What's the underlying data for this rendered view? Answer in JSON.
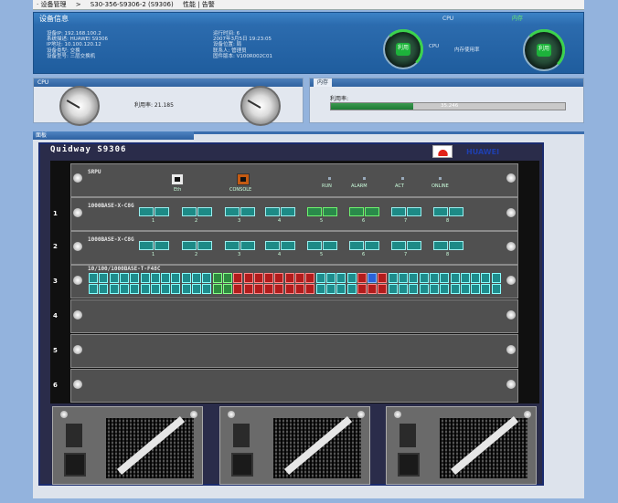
{
  "topbar": {
    "item1": "· 设备管理",
    "sep": ">",
    "item2": "S30-356-S9306-2 (S9306)",
    "item3": "性能 | 告警"
  },
  "info": {
    "header": "设备信息",
    "left_rows": [
      "设备IP: 192.168.100.2",
      "系统描述: HUAWEI S9306",
      "IP地址: 10.100.120.12",
      "设备类型: 交换",
      "设备型号: 三层交换机"
    ],
    "mid_rows": [
      "运行时间: 6",
      "2007年3月5日 19:23:05",
      "设备位置: 局",
      "联系人: 管理员",
      "固件版本: V100R002C01"
    ],
    "top_right_a": "CPU",
    "top_right_b": "内存",
    "gauge1_label": "CPU",
    "gauge1_value": "利用",
    "gauge2_label": "利用",
    "gauge2_text": "内存使用率"
  },
  "cpu_panel": {
    "title": "CPU",
    "readout": "利用率: 21.185"
  },
  "mem_panel": {
    "title": "内存",
    "label": "利用率:",
    "bar_value": "35.246",
    "fill_fraction": 0.35
  },
  "device": {
    "tab": "面板",
    "chassis_title": "Quidway S9306",
    "brand": "HUAWEI",
    "slots": [
      {
        "num": "",
        "label": "SRPU",
        "ports": [
          "Eth",
          "CONSOLE",
          "RUN",
          "ALARM",
          "ACT",
          "ONLINE"
        ]
      },
      {
        "num": "1",
        "label": "1000BASE-X-C8G",
        "ports": [
          "1",
          "2",
          "3",
          "4",
          "5",
          "6",
          "7",
          "8"
        ]
      },
      {
        "num": "2",
        "label": "1000BASE-X-C8G",
        "ports": [
          "1",
          "2",
          "3",
          "4",
          "5",
          "6",
          "7",
          "8"
        ]
      },
      {
        "num": "3",
        "label": "10/100/1000BASE-T-F48C",
        "ports": []
      },
      {
        "num": "4",
        "label": "",
        "ports": []
      },
      {
        "num": "5",
        "label": "",
        "ports": []
      },
      {
        "num": "6",
        "label": "",
        "ports": []
      }
    ]
  }
}
